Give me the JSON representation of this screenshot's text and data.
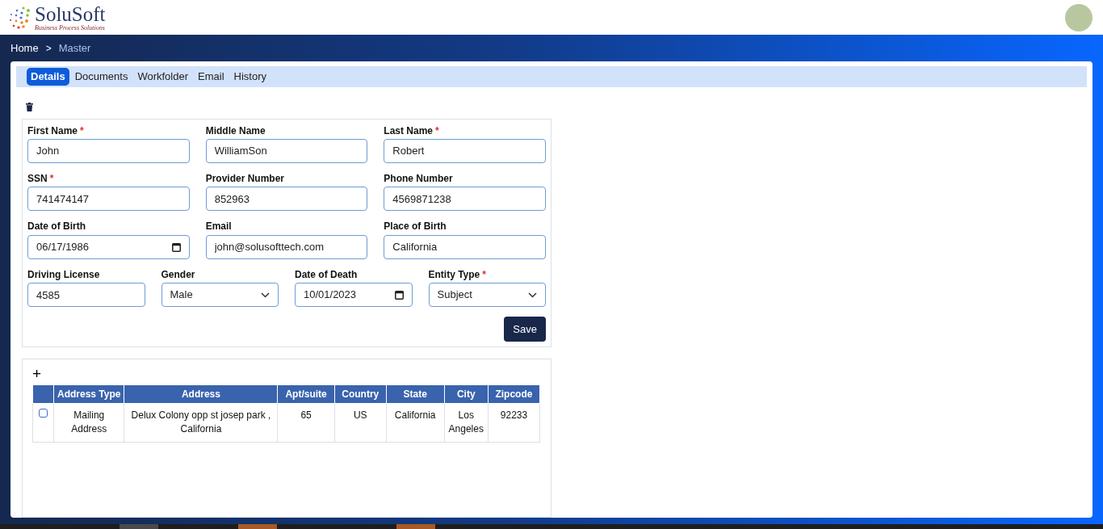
{
  "header": {
    "brand": "SoluSoft",
    "tagline": "Business Process Solutions"
  },
  "breadcrumb": [
    {
      "label": "Home",
      "current": false
    },
    {
      "label": "Master",
      "current": true
    }
  ],
  "breadcrumb_separator": ">",
  "tabs": [
    {
      "label": "Details",
      "selected": true
    },
    {
      "label": "Documents",
      "selected": false
    },
    {
      "label": "Workfolder",
      "selected": false
    },
    {
      "label": "Email",
      "selected": false
    },
    {
      "label": "History",
      "selected": false
    }
  ],
  "form": {
    "rows": [
      [
        {
          "label": "First Name",
          "required": true,
          "kind": "text",
          "value": "John"
        },
        {
          "label": "Middle Name",
          "required": false,
          "kind": "text",
          "value": "WilliamSon"
        },
        {
          "label": "Last Name",
          "required": true,
          "kind": "text",
          "value": "Robert"
        }
      ],
      [
        {
          "label": "SSN",
          "required": true,
          "kind": "text",
          "value": "741474147"
        },
        {
          "label": "Provider Number",
          "required": false,
          "kind": "text",
          "value": "852963"
        },
        {
          "label": "Phone Number",
          "required": false,
          "kind": "text",
          "value": "4569871238"
        }
      ],
      [
        {
          "label": "Date of Birth",
          "required": false,
          "kind": "date",
          "value": "06/17/1986"
        },
        {
          "label": "Email",
          "required": false,
          "kind": "text",
          "value": "john@solusofttech.com"
        },
        {
          "label": "Place of Birth",
          "required": false,
          "kind": "text",
          "value": "California"
        }
      ],
      [
        {
          "label": "Driving License",
          "required": false,
          "kind": "text",
          "value": "4585"
        },
        {
          "label": "Gender",
          "required": false,
          "kind": "select",
          "value": "Male"
        },
        {
          "label": "Date of Death",
          "required": false,
          "kind": "date",
          "value": "10/01/2023"
        },
        {
          "label": "Entity Type",
          "required": true,
          "kind": "select",
          "value": "Subject"
        }
      ]
    ],
    "required_mark": "*",
    "save_button": "Save"
  },
  "address_table": {
    "add_button": "+",
    "columns": [
      "Address Type",
      "Address",
      "Apt/suite",
      "Country",
      "State",
      "City",
      "Zipcode"
    ],
    "rows": [
      {
        "checked": false,
        "cells": [
          "Mailing Address",
          "Delux Colony opp st josep park , California",
          "65",
          "US",
          "California",
          "Los Angeles",
          "92233"
        ]
      }
    ]
  }
}
